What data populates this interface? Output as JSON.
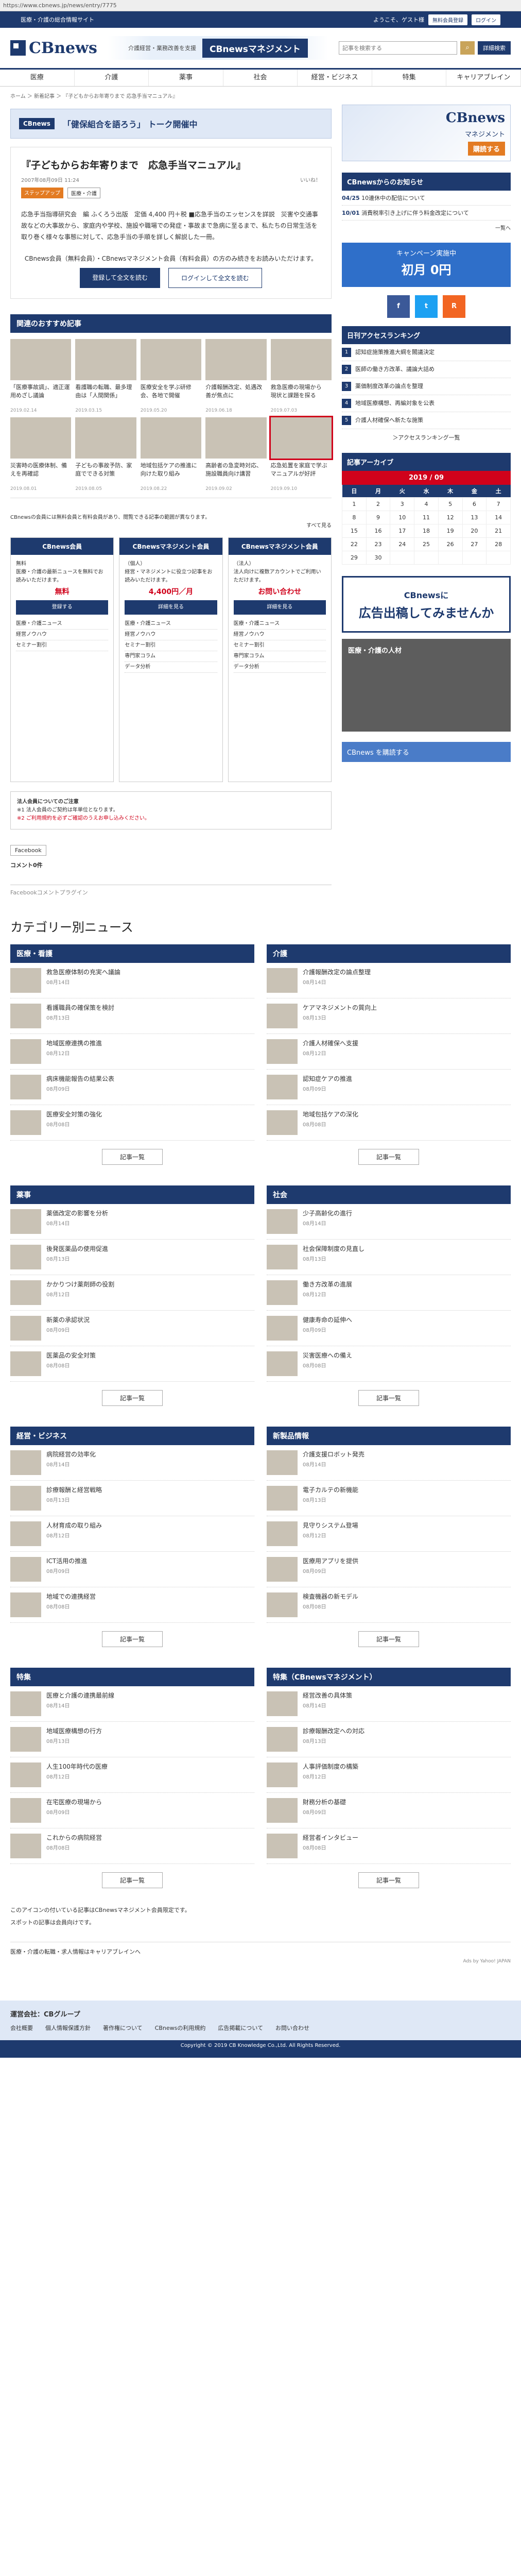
{
  "browser": {
    "url": "https://www.cbnews.jp/news/entry/7775"
  },
  "topbar": {
    "left": "医療・介護の総合情報サイト",
    "welcome": "ようこそ、ゲスト様",
    "reg": "無料会員登録",
    "login": "ログイン"
  },
  "header": {
    "logo": "CBnews",
    "banner_sub": "介護経営・業務改善を支援",
    "banner_main": "CBnewsマネジメント",
    "search_placeholder": "記事を検索する",
    "adv": "詳細検索"
  },
  "nav": [
    "医療",
    "介護",
    "薬事",
    "社会",
    "経営・ビジネス",
    "特集",
    "キャリアブレイン"
  ],
  "breadcrumb": "ホーム ＞ 新着記事 ＞ 『子どもからお年寄りまで 応急手当マニュアル』",
  "adbar": {
    "mk": "CBnews",
    "cap": "「健保組合を語ろう」 トーク開催中"
  },
  "article": {
    "title": "『子どもからお年寄りまで　応急手当マニュアル』",
    "date": "2007年08月09日 11:24",
    "like": "いいね！",
    "tag1": "ステップアップ",
    "tag2": "医療・介護",
    "body": "応急手当指導研究会　編 ふくろう出版　定価 4,400 円＋税 ■応急手当のエッセンスを詳説　災害や交通事故などの大事故から、家庭内や学校、施設や職場での発症・事故まで急病に至るまで、私たちの日常生活を取り巻く様々な事態に対して、応急手当の手順を詳しく解説した一冊。",
    "cta": "CBnews会員（無料会員）・CBnewsマネジメント会員（有料会員）の方のみ続きをお読みいただけます。",
    "reg_btn": "登録して全文を読む",
    "login_btn": "ログインして全文を読む"
  },
  "recos": {
    "heading": "関連のおすすめ記事",
    "items": [
      {
        "title": "「医療事故調」、適正運用めざし議論",
        "date": "2019.02.14"
      },
      {
        "title": "看護職の転職、最多理由は「人間関係」",
        "date": "2019.03.15"
      },
      {
        "title": "医療安全を学ぶ研修会、各地で開催",
        "date": "2019.05.20"
      },
      {
        "title": "介護報酬改定、処遇改善が焦点に",
        "date": "2019.06.18"
      },
      {
        "title": "救急医療の現場から　現状と課題を探る",
        "date": "2019.07.03"
      },
      {
        "title": "災害時の医療体制、備えを再確認",
        "date": "2019.08.01"
      },
      {
        "title": "子どもの事故予防、家庭でできる対策",
        "date": "2019.08.05"
      },
      {
        "title": "地域包括ケアの推進に向けた取り組み",
        "date": "2019.08.22"
      },
      {
        "title": "高齢者の急変時対応、施設職員向け講習",
        "date": "2019.09.02"
      },
      {
        "title": "応急処置を家庭で学ぶ　マニュアルが好評",
        "date": "2019.09.10"
      }
    ]
  },
  "membership": {
    "intro": "CBnewsの会員には無料会員と有料会員があり、閲覧できる記事の範囲が異なります。",
    "more": "すべて見る",
    "plans": [
      {
        "name": "CBnews会員",
        "sub": "無料",
        "desc": "医療・介護の最新ニュースを無料でお読みいただけます。",
        "price": "無料",
        "btn": "登録する"
      },
      {
        "name": "CBnewsマネジメント会員",
        "sub": "（個人）",
        "desc": "経営・マネジメントに役立つ記事をお読みいただけます。",
        "price": "4,400円／月",
        "btn": "詳細を見る"
      },
      {
        "name": "CBnewsマネジメント会員",
        "sub": "（法人）",
        "desc": "法人向けに複数アカウントでご利用いただけます。",
        "price": "お問い合わせ",
        "btn": "詳細を見る"
      }
    ],
    "features": [
      "医療・介護ニュース",
      "経営ノウハウ",
      "セミナー割引",
      "専門家コラム",
      "データ分析"
    ]
  },
  "note": {
    "title": "法人会員についてのご注意",
    "text": "※1 法人会員のご契約は年単位となります。",
    "red": "※2 ご利用規約を必ずご確認のうえお申し込みください。"
  },
  "fb": {
    "label": "Facebook",
    "comments": "コメント0件",
    "footer": "Facebookコメントプラグイン"
  },
  "side": {
    "banner": {
      "title": "CBnews",
      "sub": "マネジメント",
      "go": "購読する"
    },
    "news": {
      "h": "CBnewsからのお知らせ",
      "items": [
        {
          "d": "04/25",
          "t": "10連休中の配信について"
        },
        {
          "d": "10/01",
          "t": "消費税率引き上げに伴う料金改定について"
        }
      ],
      "more": "一覧へ"
    },
    "camp": {
      "a": "キャンペーン実施中",
      "b": "初月 0円"
    },
    "social": [
      "f",
      "t",
      "R"
    ],
    "rank": {
      "h": "日刊アクセスランキング",
      "items": [
        "認知症施策推進大綱を閣議決定",
        "医師の働き方改革、議論大詰め",
        "薬価制度改革の論点を整理",
        "地域医療構想、再編対象を公表",
        "介護人材確保へ新たな施策"
      ],
      "more": "＞アクセスランキング一覧"
    },
    "cal": {
      "h": "記事アーカイブ",
      "month": "2019 / 09",
      "dow": [
        "日",
        "月",
        "火",
        "水",
        "木",
        "金",
        "土"
      ],
      "days": [
        "1",
        "2",
        "3",
        "4",
        "5",
        "6",
        "7",
        "8",
        "9",
        "10",
        "11",
        "12",
        "13",
        "14",
        "15",
        "16",
        "17",
        "18",
        "19",
        "20",
        "21",
        "22",
        "23",
        "24",
        "25",
        "26",
        "27",
        "28",
        "29",
        "30"
      ]
    },
    "ban2": {
      "a": "CBnewsに",
      "b": "広告出稿してみませんか"
    },
    "photo": "医療・介護の人材",
    "rss": "CBnews を購読する"
  },
  "categories": {
    "heading": "カテゴリー別ニュース",
    "more": "記事一覧",
    "boxes": [
      {
        "name": "医療・看護",
        "items": [
          {
            "t": "救急医療体制の充実へ議論",
            "d": "08月14日"
          },
          {
            "t": "看護職員の確保策を検討",
            "d": "08月13日"
          },
          {
            "t": "地域医療連携の推進",
            "d": "08月12日"
          },
          {
            "t": "病床機能報告の結果公表",
            "d": "08月09日"
          },
          {
            "t": "医療安全対策の強化",
            "d": "08月08日"
          }
        ]
      },
      {
        "name": "介護",
        "items": [
          {
            "t": "介護報酬改定の論点整理",
            "d": "08月14日"
          },
          {
            "t": "ケアマネジメントの質向上",
            "d": "08月13日"
          },
          {
            "t": "介護人材確保へ支援",
            "d": "08月12日"
          },
          {
            "t": "認知症ケアの推進",
            "d": "08月09日"
          },
          {
            "t": "地域包括ケアの深化",
            "d": "08月08日"
          }
        ]
      },
      {
        "name": "薬事",
        "items": [
          {
            "t": "薬価改定の影響を分析",
            "d": "08月14日"
          },
          {
            "t": "後発医薬品の使用促進",
            "d": "08月13日"
          },
          {
            "t": "かかりつけ薬剤師の役割",
            "d": "08月12日"
          },
          {
            "t": "新薬の承認状況",
            "d": "08月09日"
          },
          {
            "t": "医薬品の安全対策",
            "d": "08月08日"
          }
        ]
      },
      {
        "name": "社会",
        "items": [
          {
            "t": "少子高齢化の進行",
            "d": "08月14日"
          },
          {
            "t": "社会保障制度の見直し",
            "d": "08月13日"
          },
          {
            "t": "働き方改革の進展",
            "d": "08月12日"
          },
          {
            "t": "健康寿命の延伸へ",
            "d": "08月09日"
          },
          {
            "t": "災害医療への備え",
            "d": "08月08日"
          }
        ]
      },
      {
        "name": "経営・ビジネス",
        "items": [
          {
            "t": "病院経営の効率化",
            "d": "08月14日"
          },
          {
            "t": "診療報酬と経営戦略",
            "d": "08月13日"
          },
          {
            "t": "人材育成の取り組み",
            "d": "08月12日"
          },
          {
            "t": "ICT活用の推進",
            "d": "08月09日"
          },
          {
            "t": "地域での連携経営",
            "d": "08月08日"
          }
        ]
      },
      {
        "name": "新製品情報",
        "items": [
          {
            "t": "介護支援ロボット発売",
            "d": "08月14日"
          },
          {
            "t": "電子カルテの新機能",
            "d": "08月13日"
          },
          {
            "t": "見守りシステム登場",
            "d": "08月12日"
          },
          {
            "t": "医療用アプリを提供",
            "d": "08月09日"
          },
          {
            "t": "検査機器の新モデル",
            "d": "08月08日"
          }
        ]
      },
      {
        "name": "特集",
        "items": [
          {
            "t": "医療と介護の連携最前線",
            "d": "08月14日"
          },
          {
            "t": "地域医療構想の行方",
            "d": "08月13日"
          },
          {
            "t": "人生100年時代の医療",
            "d": "08月12日"
          },
          {
            "t": "在宅医療の現場から",
            "d": "08月09日"
          },
          {
            "t": "これからの病院経営",
            "d": "08月08日"
          }
        ]
      },
      {
        "name": "特集（CBnewsマネジメント）",
        "items": [
          {
            "t": "経営改善の具体策",
            "d": "08月14日"
          },
          {
            "t": "診療報酬改定への対応",
            "d": "08月13日"
          },
          {
            "t": "人事評価制度の構築",
            "d": "08月12日"
          },
          {
            "t": "財務分析の基礎",
            "d": "08月09日"
          },
          {
            "t": "経営者インタビュー",
            "d": "08月08日"
          }
        ]
      }
    ]
  },
  "tail": {
    "note": "このアイコンの付いている記事はCBnewsマネジメント会員限定です。",
    "login": "スポットの記事は会員向けです。",
    "ad": "医療・介護の転職・求人情報はキャリアブレインへ",
    "adby": "Ads by Yahoo! JAPAN"
  },
  "footer": {
    "company": "運営会社：CBグループ",
    "links": [
      "会社概要",
      "個人情報保護方針",
      "著作権について",
      "CBnewsの利用規約",
      "広告掲載について",
      "お問い合わせ"
    ],
    "copy": "Copyright © 2019 CB Knowledge Co.,Ltd. All Rights Reserved."
  }
}
